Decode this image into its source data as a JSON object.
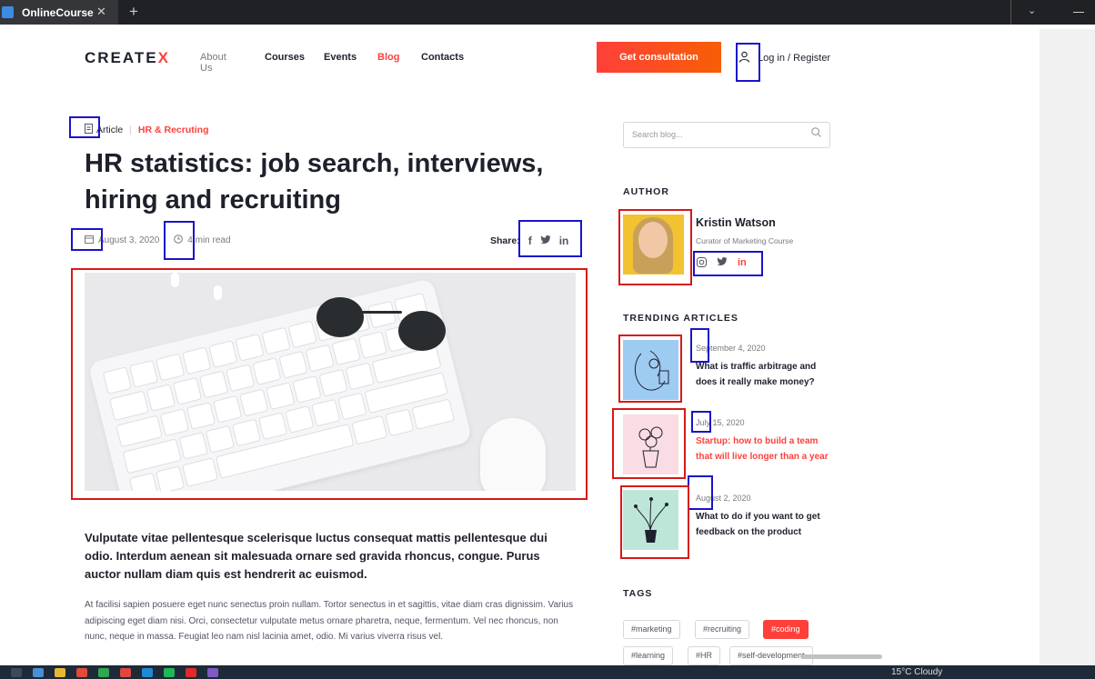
{
  "browser": {
    "tab_title": "OnlineCourse",
    "tab_close": "✕",
    "new_tab": "+",
    "menu": "⌄"
  },
  "header": {
    "logo_text": "CREATE",
    "logo_mark": "X",
    "nav": [
      "About Us",
      "Courses",
      "Events",
      "Blog",
      "Contacts"
    ],
    "active_nav": "Blog",
    "cta_label": "Get consultation",
    "login_label": "Log in / Register",
    "login_icon": "user-icon"
  },
  "article": {
    "type_label": "Article",
    "category": "HR & Recruting",
    "title": "HR statistics: job search,  interviews, hiring and recruiting",
    "date": "August 3, 2020",
    "read_time": "4 min read",
    "share_label": "Share:",
    "share_icons": [
      "facebook-icon",
      "twitter-icon",
      "linkedin-icon"
    ],
    "lead": "Vulputate vitae pellentesque scelerisque luctus consequat mattis pellentesque dui odio. Interdum aenean sit malesuada ornare sed gravida rhoncus, congue. Purus auctor nullam diam quis est hendrerit ac euismod.",
    "body": "At facilisi sapien posuere eget nunc senectus proin nullam. Tortor senectus in et sagittis, vitae diam cras dignissim. Varius adipiscing eget diam nisi. Orci, consectetur vulputate metus ornare pharetra, neque, fermentum. Vel nec rhoncus, non nunc, neque in massa. Feugiat leo nam nisl lacinia amet, odio. Mi varius viverra risus vel."
  },
  "sidebar": {
    "search_placeholder": "Search blog...",
    "author_heading": "AUTHOR",
    "author_name": "Kristin Watson",
    "author_role": "Curator of Marketing Course",
    "author_social": [
      "instagram-icon",
      "twitter-icon",
      "linkedin-icon"
    ],
    "trending_heading": "TRENDING ARTICLES",
    "trending": [
      {
        "date": "September 4, 2020",
        "title": "What is traffic arbitrage and does it really make money?",
        "highlight": false
      },
      {
        "date": "July 15, 2020",
        "title": "Startup: how to build a team that will live longer than a year",
        "highlight": true
      },
      {
        "date": "August 2, 2020",
        "title": "What to do if you want to get feedback on the product",
        "highlight": false
      }
    ],
    "tags_heading": "TAGS",
    "tags": [
      "#marketing",
      "#recruiting",
      "#coding",
      "#learning",
      "#HR",
      "#self-development"
    ],
    "active_tag": "#coding"
  },
  "colors": {
    "accent": "#ff3f3a",
    "text": "#1e212c",
    "muted": "#787a80",
    "annotation_blue": "#1b13c8",
    "annotation_red": "#d81818"
  },
  "taskbar": {
    "weather": "15°C  Cloudy"
  }
}
